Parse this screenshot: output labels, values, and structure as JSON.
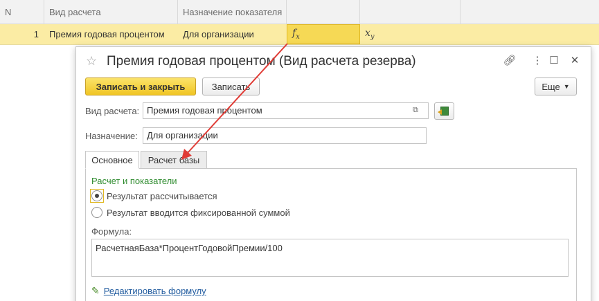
{
  "table": {
    "headers": {
      "n": "N",
      "vid": "Вид расчета",
      "naz": "Назначение показателя"
    },
    "rows": [
      {
        "n": "1",
        "vid": "Премия годовая процентом",
        "naz": "Для организации"
      }
    ]
  },
  "form": {
    "title": "Премия годовая процентом (Вид расчета резерва)",
    "buttons": {
      "save_close": "Записать и закрыть",
      "save": "Записать",
      "more": "Еще"
    },
    "fields": {
      "vid_label": "Вид расчета:",
      "vid_value": "Премия годовая процентом",
      "naz_label": "Назначение:",
      "naz_value": "Для организации"
    },
    "tabs": [
      {
        "label": "Основное",
        "active": true
      },
      {
        "label": "Расчет базы",
        "active": false
      }
    ],
    "section_title": "Расчет и показатели",
    "radios": [
      {
        "label": "Результат рассчитывается",
        "checked": true
      },
      {
        "label": "Результат вводится фиксированной суммой",
        "checked": false
      }
    ],
    "formula_label": "Формула:",
    "formula_value": "РасчетнаяБаза*ПроцентГодовойПремии/100",
    "edit_formula_link": "Редактировать формулу"
  },
  "colors": {
    "highlight_row": "#fbeca4",
    "primary_button": "#f0c524",
    "section_title": "#2e8b2e",
    "link": "#1f5a9e",
    "annotation_arrow": "#e03b35"
  },
  "icons": [
    "star-icon",
    "link-icon",
    "menu-icon",
    "maximize-icon",
    "close-icon",
    "open-icon",
    "excel-icon",
    "pencil-icon",
    "fx-icon",
    "xy-icon"
  ]
}
